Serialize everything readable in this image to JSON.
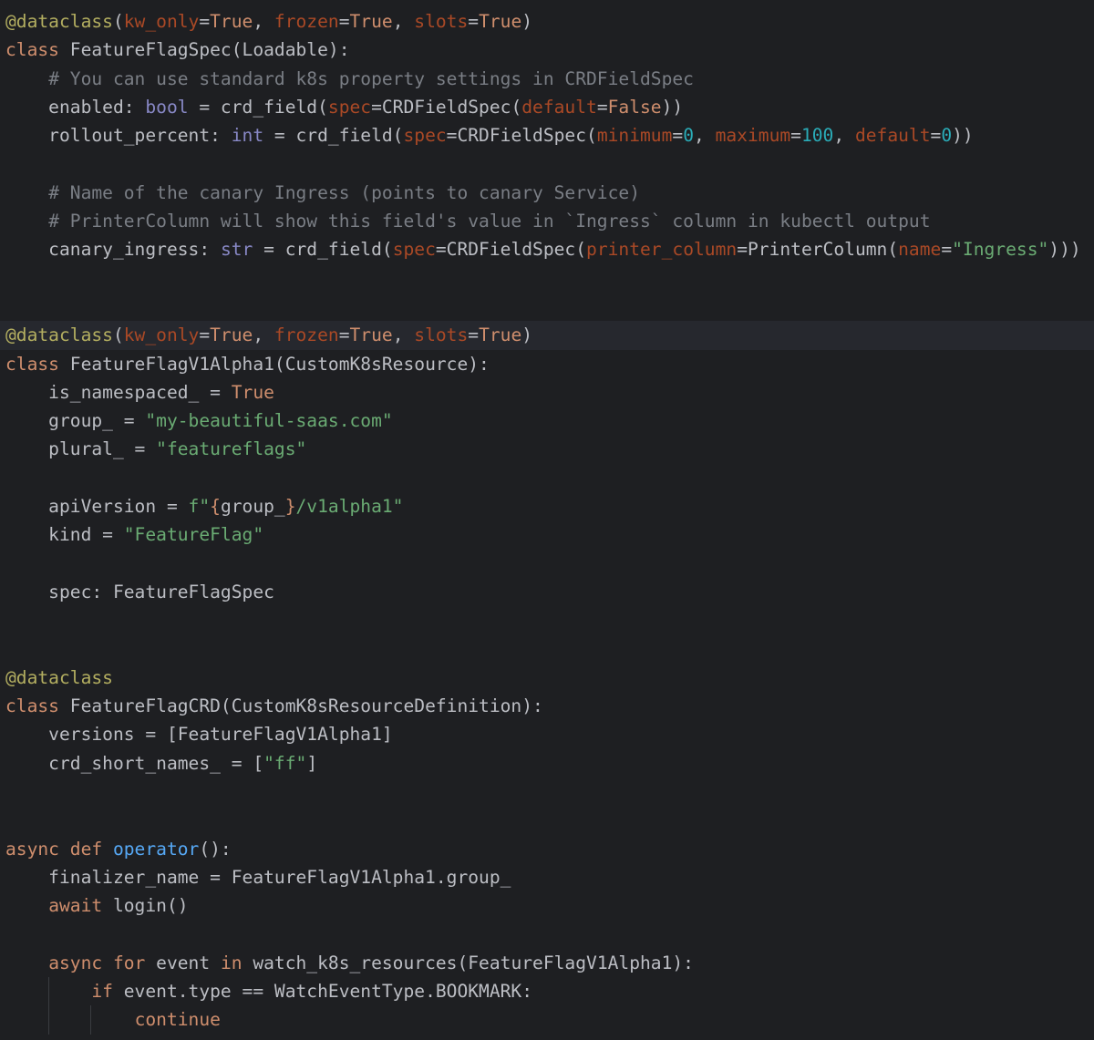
{
  "lines": [
    {
      "segments": [
        {
          "cls": "dec",
          "text": "@dataclass"
        },
        {
          "cls": "pl",
          "text": "("
        },
        {
          "cls": "par",
          "text": "kw_only"
        },
        {
          "cls": "pl",
          "text": "="
        },
        {
          "cls": "kw",
          "text": "True"
        },
        {
          "cls": "pl",
          "text": ", "
        },
        {
          "cls": "par",
          "text": "frozen"
        },
        {
          "cls": "pl",
          "text": "="
        },
        {
          "cls": "kw",
          "text": "True"
        },
        {
          "cls": "pl",
          "text": ", "
        },
        {
          "cls": "par",
          "text": "slots"
        },
        {
          "cls": "pl",
          "text": "="
        },
        {
          "cls": "kw",
          "text": "True"
        },
        {
          "cls": "pl",
          "text": ")"
        }
      ]
    },
    {
      "segments": [
        {
          "cls": "kw",
          "text": "class "
        },
        {
          "cls": "pl",
          "text": "FeatureFlagSpec(Loadable):"
        }
      ]
    },
    {
      "segments": [
        {
          "cls": "pl",
          "text": "    "
        },
        {
          "cls": "cm",
          "text": "# You can use standard k8s property settings in CRDFieldSpec"
        }
      ]
    },
    {
      "segments": [
        {
          "cls": "pl",
          "text": "    enabled: "
        },
        {
          "cls": "bi",
          "text": "bool"
        },
        {
          "cls": "pl",
          "text": " = crd_field("
        },
        {
          "cls": "par",
          "text": "spec"
        },
        {
          "cls": "pl",
          "text": "=CRDFieldSpec("
        },
        {
          "cls": "par",
          "text": "default"
        },
        {
          "cls": "pl",
          "text": "="
        },
        {
          "cls": "kw",
          "text": "False"
        },
        {
          "cls": "pl",
          "text": "))"
        }
      ]
    },
    {
      "segments": [
        {
          "cls": "pl",
          "text": "    rollout_percent: "
        },
        {
          "cls": "bi",
          "text": "int"
        },
        {
          "cls": "pl",
          "text": " = crd_field("
        },
        {
          "cls": "par",
          "text": "spec"
        },
        {
          "cls": "pl",
          "text": "=CRDFieldSpec("
        },
        {
          "cls": "par",
          "text": "minimum"
        },
        {
          "cls": "pl",
          "text": "="
        },
        {
          "cls": "num",
          "text": "0"
        },
        {
          "cls": "pl",
          "text": ", "
        },
        {
          "cls": "par",
          "text": "maximum"
        },
        {
          "cls": "pl",
          "text": "="
        },
        {
          "cls": "num",
          "text": "100"
        },
        {
          "cls": "pl",
          "text": ", "
        },
        {
          "cls": "par",
          "text": "default"
        },
        {
          "cls": "pl",
          "text": "="
        },
        {
          "cls": "num",
          "text": "0"
        },
        {
          "cls": "pl",
          "text": "))"
        }
      ]
    },
    {
      "segments": []
    },
    {
      "segments": [
        {
          "cls": "pl",
          "text": "    "
        },
        {
          "cls": "cm",
          "text": "# Name of the canary Ingress (points to canary Service)"
        }
      ]
    },
    {
      "segments": [
        {
          "cls": "pl",
          "text": "    "
        },
        {
          "cls": "cm",
          "text": "# PrinterColumn will show this field's value in `Ingress` column in kubectl output"
        }
      ]
    },
    {
      "segments": [
        {
          "cls": "pl",
          "text": "    canary_ingress: "
        },
        {
          "cls": "bi",
          "text": "str"
        },
        {
          "cls": "pl",
          "text": " = crd_field("
        },
        {
          "cls": "par",
          "text": "spec"
        },
        {
          "cls": "pl",
          "text": "=CRDFieldSpec("
        },
        {
          "cls": "par",
          "text": "printer_column"
        },
        {
          "cls": "pl",
          "text": "=PrinterColumn("
        },
        {
          "cls": "par",
          "text": "name"
        },
        {
          "cls": "pl",
          "text": "="
        },
        {
          "cls": "str",
          "text": "\"Ingress\""
        },
        {
          "cls": "pl",
          "text": ")))"
        }
      ]
    },
    {
      "segments": []
    },
    {
      "segments": []
    },
    {
      "current": true,
      "segments": [
        {
          "cls": "dec",
          "text": "@dataclass"
        },
        {
          "cls": "pl",
          "text": "("
        },
        {
          "cls": "par",
          "text": "kw_only"
        },
        {
          "cls": "pl",
          "text": "="
        },
        {
          "cls": "kw",
          "text": "True"
        },
        {
          "cls": "pl",
          "text": ", "
        },
        {
          "cls": "par",
          "text": "frozen"
        },
        {
          "cls": "pl",
          "text": "="
        },
        {
          "cls": "kw",
          "text": "True"
        },
        {
          "cls": "pl",
          "text": ", "
        },
        {
          "cls": "par",
          "text": "slots"
        },
        {
          "cls": "pl",
          "text": "="
        },
        {
          "cls": "kw",
          "text": "True"
        },
        {
          "cls": "pl",
          "text": ")"
        }
      ]
    },
    {
      "segments": [
        {
          "cls": "kw",
          "text": "class "
        },
        {
          "cls": "pl",
          "text": "FeatureFlagV1Alpha1(CustomK8sResource):"
        }
      ]
    },
    {
      "segments": [
        {
          "cls": "pl",
          "text": "    is_namespaced_ = "
        },
        {
          "cls": "kw",
          "text": "True"
        }
      ]
    },
    {
      "segments": [
        {
          "cls": "pl",
          "text": "    group_ = "
        },
        {
          "cls": "str",
          "text": "\"my-beautiful-saas.com\""
        }
      ]
    },
    {
      "segments": [
        {
          "cls": "pl",
          "text": "    plural_ = "
        },
        {
          "cls": "str",
          "text": "\"featureflags\""
        }
      ]
    },
    {
      "segments": []
    },
    {
      "segments": [
        {
          "cls": "pl",
          "text": "    apiVersion = "
        },
        {
          "cls": "str",
          "text": "f\""
        },
        {
          "cls": "brace",
          "text": "{"
        },
        {
          "cls": "pl",
          "text": "group_"
        },
        {
          "cls": "brace",
          "text": "}"
        },
        {
          "cls": "str",
          "text": "/v1alpha1\""
        }
      ]
    },
    {
      "segments": [
        {
          "cls": "pl",
          "text": "    kind = "
        },
        {
          "cls": "str",
          "text": "\"FeatureFlag\""
        }
      ]
    },
    {
      "segments": []
    },
    {
      "segments": [
        {
          "cls": "pl",
          "text": "    spec: FeatureFlagSpec"
        }
      ]
    },
    {
      "segments": []
    },
    {
      "segments": []
    },
    {
      "segments": [
        {
          "cls": "dec",
          "text": "@dataclass"
        }
      ]
    },
    {
      "segments": [
        {
          "cls": "kw",
          "text": "class "
        },
        {
          "cls": "pl",
          "text": "FeatureFlagCRD(CustomK8sResourceDefinition):"
        }
      ]
    },
    {
      "segments": [
        {
          "cls": "pl",
          "text": "    versions = [FeatureFlagV1Alpha1]"
        }
      ]
    },
    {
      "segments": [
        {
          "cls": "pl",
          "text": "    crd_short_names_ = ["
        },
        {
          "cls": "str",
          "text": "\"ff\""
        },
        {
          "cls": "pl",
          "text": "]"
        }
      ]
    },
    {
      "segments": []
    },
    {
      "segments": []
    },
    {
      "segments": [
        {
          "cls": "kw",
          "text": "async def "
        },
        {
          "cls": "fn",
          "text": "operator"
        },
        {
          "cls": "pl",
          "text": "():"
        }
      ]
    },
    {
      "segments": [
        {
          "cls": "pl",
          "text": "    finalizer_name = FeatureFlagV1Alpha1.group_"
        }
      ]
    },
    {
      "segments": [
        {
          "cls": "pl",
          "text": "    "
        },
        {
          "cls": "kw",
          "text": "await "
        },
        {
          "cls": "pl",
          "text": "login()"
        }
      ]
    },
    {
      "segments": []
    },
    {
      "segments": [
        {
          "cls": "pl",
          "text": "    "
        },
        {
          "cls": "kw",
          "text": "async for "
        },
        {
          "cls": "pl",
          "text": "event "
        },
        {
          "cls": "kw",
          "text": "in "
        },
        {
          "cls": "pl",
          "text": "watch_k8s_resources(FeatureFlagV1Alpha1):"
        }
      ]
    },
    {
      "guides": [
        1
      ],
      "segments": [
        {
          "cls": "pl",
          "text": "        "
        },
        {
          "cls": "kw",
          "text": "if "
        },
        {
          "cls": "pl",
          "text": "event.type == WatchEventType.BOOKMARK:"
        }
      ]
    },
    {
      "guides": [
        1,
        2
      ],
      "segments": [
        {
          "cls": "pl",
          "text": "            "
        },
        {
          "cls": "kw",
          "text": "continue"
        }
      ]
    }
  ]
}
